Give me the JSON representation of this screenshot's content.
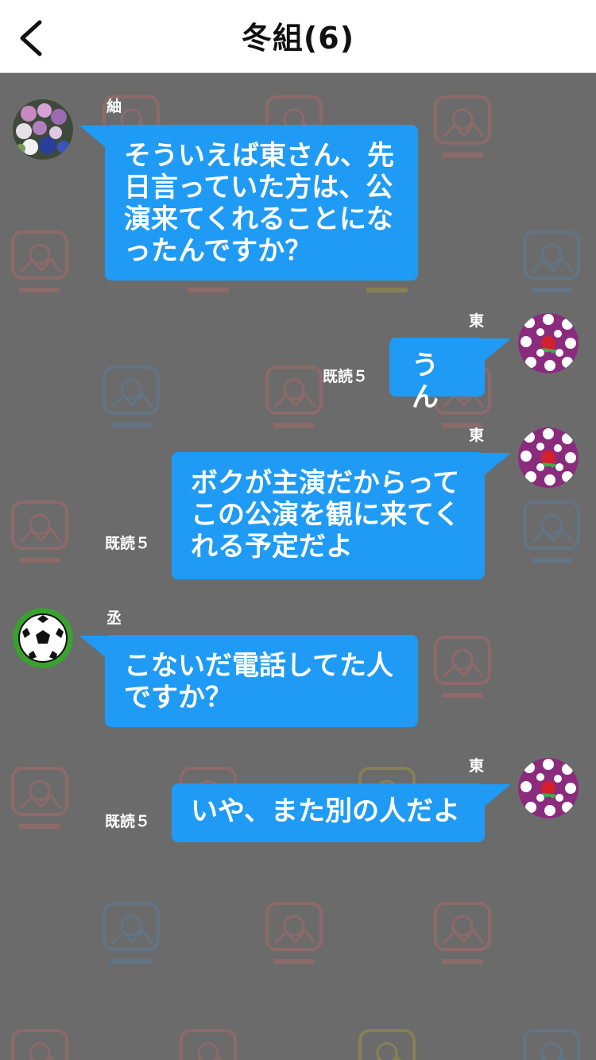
{
  "header": {
    "title": "冬組(6)",
    "back_icon": "chevron-left-icon"
  },
  "messages": [
    {
      "side": "left",
      "sender": "紬",
      "avatar": "flower-garden-avatar",
      "text": "そういえば東さん、先\n日言っていた方は、公\n演来てくれることにな\nったんですか？"
    },
    {
      "side": "right",
      "sender": "東",
      "avatar": "purple-floral-avatar",
      "text": "うん",
      "read": "既読５"
    },
    {
      "side": "right",
      "sender": "東",
      "avatar": "purple-floral-avatar",
      "text": "ボクが主演だからって\nこの公演を観に来てく\nれる予定だよ",
      "read": "既読５"
    },
    {
      "side": "left",
      "sender": "丞",
      "avatar": "soccer-ball-avatar",
      "text": "こないだ電話してた人\nですか？"
    },
    {
      "side": "right",
      "sender": "東",
      "avatar": "purple-floral-avatar",
      "text": "いや、また別の人だよ",
      "read": "既読５"
    }
  ],
  "colors": {
    "bubble": "#1f9bf5",
    "background": "#6b6b6b",
    "header_bg": "#ffffff"
  }
}
